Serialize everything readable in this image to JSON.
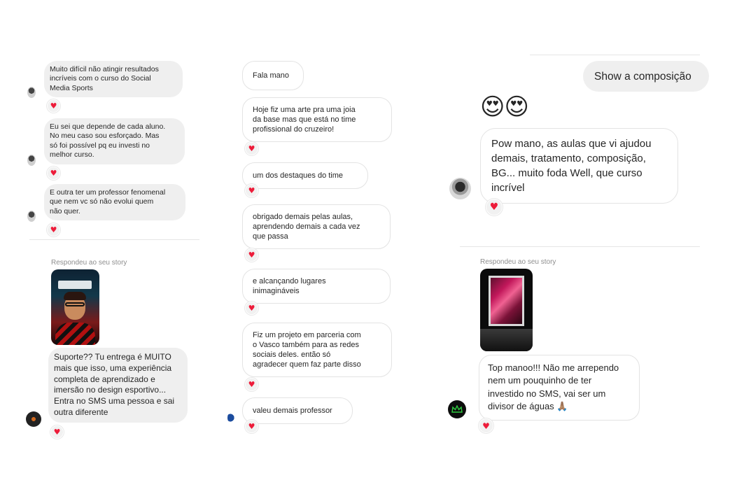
{
  "panel_left": {
    "messages": [
      {
        "text": "Muito difícil não atingir resultados\nincríveis com o curso do Social\nMedia Sports"
      },
      {
        "text": "Eu sei que depende de cada aluno.\nNo meu caso sou esforçado. Mas\nsó foi possível pq eu investi no\nmelhor curso."
      },
      {
        "text": "E outra ter um professor fenomenal\nque nem vc só não evolui quem\nnão quer."
      }
    ],
    "story_label": "Respondeu ao seu story",
    "story_reply": "Suporte?? Tu entrega é MUITO\nmais que isso, uma experiência\ncompleta de aprendizado e\nimersão no design esportivo...\nEntra no SMS uma pessoa e sai\noutra diferente"
  },
  "panel_middle": {
    "messages": [
      {
        "text": "Fala mano"
      },
      {
        "text": "Hoje fiz uma arte pra uma joia\nda base mas que está no time\nprofissional do cruzeiro!"
      },
      {
        "text": "um dos destaques do time"
      },
      {
        "text": "obrigado demais pelas aulas,\naprendendo demais a cada vez\nque passa"
      },
      {
        "text": "e alcançando lugares\ninimagináveis"
      },
      {
        "text": "Fiz um projeto em parceria com\no Vasco também para as redes\nsociais deles. então só\nagradecer quem faz parte disso"
      },
      {
        "text": "valeu demais professor"
      }
    ]
  },
  "panel_right": {
    "sent_message": "Show a composição",
    "emoji_reaction": "😍😍",
    "reply": "Pow mano, as aulas que vi ajudou\ndemais, tratamento, composição,\nBG... muito foda Well, que curso\nincrível",
    "story_label": "Respondeu ao seu story",
    "story_reply": "Top manoo!!! Não me arrependo\nnem um pouquinho de ter\ninvestido no SMS, vai ser um\ndivisor de águas 🙏🏽"
  },
  "reaction_glyph": "♥",
  "icons": {
    "heart": "heart-reaction-icon",
    "avatar": "user-avatar"
  },
  "colors": {
    "bubble_gray": "#efefef",
    "heart_red": "#ed1c3a",
    "label_gray": "#8e8e8e"
  }
}
